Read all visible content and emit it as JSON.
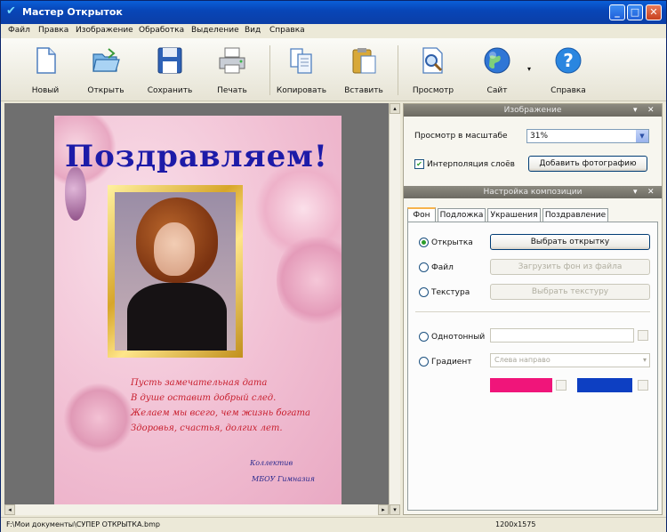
{
  "window": {
    "title": "Мастер Открыток"
  },
  "menu": [
    "Файл",
    "Правка",
    "Изображение",
    "Обработка",
    "Выделение",
    "Вид",
    "Справка"
  ],
  "toolbar": {
    "new": "Новый",
    "open": "Открыть",
    "save": "Сохранить",
    "print": "Печать",
    "copy": "Копировать",
    "paste": "Вставить",
    "preview": "Просмотр",
    "site": "Сайт",
    "help": "Справка"
  },
  "card": {
    "heading": "Поздравляем!",
    "poem": [
      "Пусть замечательная дата",
      "В душе оставит добрый след.",
      "Желаем мы всего, чем жизнь богата",
      "Здоровья, счастья, долгих лет."
    ],
    "signature": [
      "Коллектив",
      "МБОУ Гимназия"
    ]
  },
  "image_panel": {
    "header": "Изображение",
    "scale_label": "Просмотр в масштабе",
    "scale_value": "31%",
    "interpolation_label": "Интерполяция слоёв",
    "interpolation_checked": true,
    "add_photo_button": "Добавить фотографию"
  },
  "composition_panel": {
    "header": "Настройка композиции",
    "tabs": [
      "Фон",
      "Подложка",
      "Украшения",
      "Поздравление"
    ],
    "active_tab": "Фон",
    "options": {
      "postcard_label": "Открытка",
      "choose_postcard_button": "Выбрать открытку",
      "file_label": "Файл",
      "load_file_button": "Загрузить фон из файла",
      "texture_label": "Текстура",
      "choose_texture_button": "Выбрать текстуру",
      "solid_label": "Однотонный",
      "gradient_label": "Градиент",
      "gradient_direction": "Слева направо",
      "selected": "Открытка"
    },
    "colors": {
      "gradient_start": "#f0157a",
      "gradient_end": "#0d3fc2"
    }
  },
  "status": {
    "path": "F:\\Мои документы\\СУПЕР ОТКРЫТКА.bmp",
    "dimensions": "1200x1575"
  },
  "colors": {
    "titlebar": "#0846b8",
    "heading": "#1d1ba8",
    "poem": "#c81f2e"
  }
}
